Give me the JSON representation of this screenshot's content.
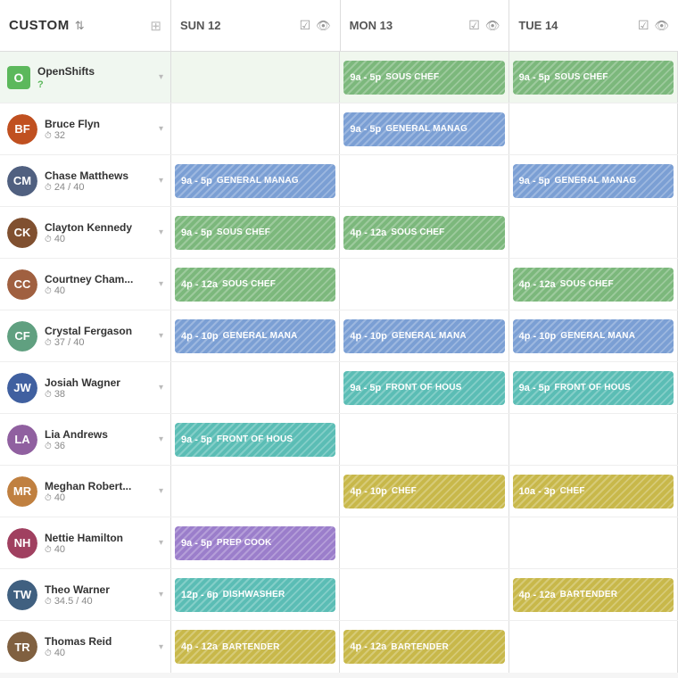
{
  "header": {
    "left_label": "CUSTOM",
    "days": [
      {
        "label": "SUN 12"
      },
      {
        "label": "MON 13"
      },
      {
        "label": "TUE 14"
      }
    ]
  },
  "open_shifts": {
    "label": "OpenShifts",
    "shifts": [
      {
        "day": 1,
        "time": "9a - 5p",
        "role": "SOUS CHEF",
        "color": "green"
      },
      {
        "day": 2,
        "time": "9a - 5p",
        "role": "SOUS CHEF",
        "color": "green"
      }
    ]
  },
  "employees": [
    {
      "name": "Bruce Flyn",
      "hours": "32",
      "avatar_color": "#c05020",
      "initials": "BF",
      "shifts": [
        {
          "day": 1,
          "time": "9a - 5p",
          "role": "GENERAL MANAG",
          "color": "blue"
        }
      ]
    },
    {
      "name": "Chase Matthews",
      "hours": "24 / 40",
      "avatar_color": "#506080",
      "initials": "CM",
      "shifts": [
        {
          "day": 0,
          "time": "9a - 5p",
          "role": "GENERAL MANAG",
          "color": "blue"
        },
        {
          "day": 2,
          "time": "9a - 5p",
          "role": "GENERAL MANAG",
          "color": "blue"
        }
      ]
    },
    {
      "name": "Clayton Kennedy",
      "hours": "40",
      "avatar_color": "#805030",
      "initials": "CK",
      "shifts": [
        {
          "day": 0,
          "time": "9a - 5p",
          "role": "SOUS CHEF",
          "color": "green"
        },
        {
          "day": 1,
          "time": "4p - 12a",
          "role": "SOUS CHEF",
          "color": "green"
        }
      ]
    },
    {
      "name": "Courtney Cham...",
      "hours": "40",
      "avatar_color": "#a06040",
      "initials": "CC",
      "shifts": [
        {
          "day": 0,
          "time": "4p - 12a",
          "role": "SOUS CHEF",
          "color": "green"
        },
        {
          "day": 2,
          "time": "4p - 12a",
          "role": "SOUS CHEF",
          "color": "green"
        }
      ]
    },
    {
      "name": "Crystal Fergason",
      "hours": "37 / 40",
      "avatar_color": "#60a080",
      "initials": "CF",
      "shifts": [
        {
          "day": 0,
          "time": "4p - 10p",
          "role": "GENERAL MANA",
          "color": "blue"
        },
        {
          "day": 1,
          "time": "4p - 10p",
          "role": "GENERAL MANA",
          "color": "blue"
        },
        {
          "day": 2,
          "time": "4p - 10p",
          "role": "GENERAL MANA",
          "color": "blue"
        }
      ]
    },
    {
      "name": "Josiah Wagner",
      "hours": "38",
      "avatar_color": "#4060a0",
      "initials": "JW",
      "shifts": [
        {
          "day": 1,
          "time": "9a - 5p",
          "role": "FRONT OF HOUS",
          "color": "teal"
        },
        {
          "day": 2,
          "time": "9a - 5p",
          "role": "FRONT OF HOUS",
          "color": "teal"
        }
      ]
    },
    {
      "name": "Lia Andrews",
      "hours": "36",
      "avatar_color": "#9060a0",
      "initials": "LA",
      "shifts": [
        {
          "day": 0,
          "time": "9a - 5p",
          "role": "FRONT OF HOUS",
          "color": "teal"
        }
      ]
    },
    {
      "name": "Meghan Robert...",
      "hours": "40",
      "avatar_color": "#c08040",
      "initials": "MR",
      "shifts": [
        {
          "day": 1,
          "time": "4p - 10p",
          "role": "CHEF",
          "color": "yellow"
        },
        {
          "day": 2,
          "time": "10a - 3p",
          "role": "CHEF",
          "color": "yellow"
        }
      ]
    },
    {
      "name": "Nettie Hamilton",
      "hours": "40",
      "avatar_color": "#a04060",
      "initials": "NH",
      "shifts": [
        {
          "day": 0,
          "time": "9a - 5p",
          "role": "PREP COOK",
          "color": "purple"
        }
      ]
    },
    {
      "name": "Theo Warner",
      "hours": "34.5 / 40",
      "avatar_color": "#406080",
      "initials": "TW",
      "shifts": [
        {
          "day": 0,
          "time": "12p - 6p",
          "role": "DISHWASHER",
          "color": "teal"
        },
        {
          "day": 2,
          "time": "4p - 12a",
          "role": "BARTENDER",
          "color": "yellow"
        }
      ]
    },
    {
      "name": "Thomas Reid",
      "hours": "40",
      "avatar_color": "#806040",
      "initials": "TR",
      "shifts": [
        {
          "day": 0,
          "time": "4p - 12a",
          "role": "BARTENDER",
          "color": "yellow"
        },
        {
          "day": 1,
          "time": "4p - 12a",
          "role": "BARTENDER",
          "color": "yellow"
        }
      ]
    }
  ]
}
